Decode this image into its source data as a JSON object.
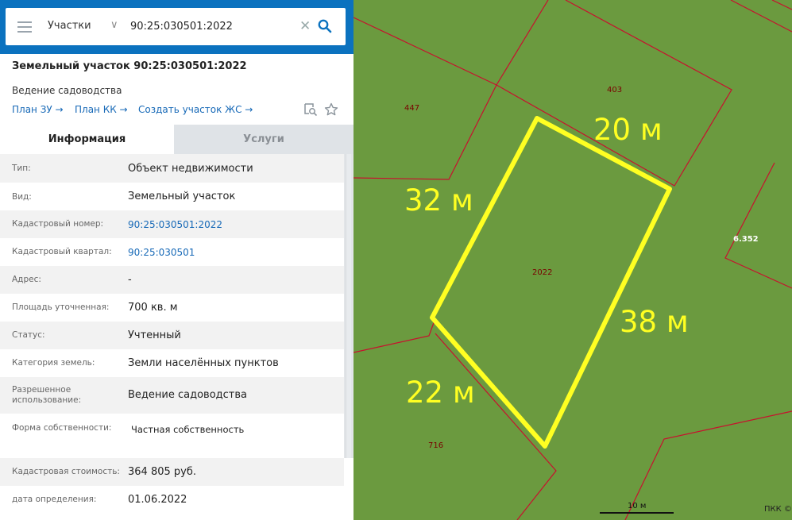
{
  "search": {
    "layer": "Участки",
    "query": "90:25:030501:2022"
  },
  "header": {
    "title": "Земельный участок 90:25:030501:2022",
    "subtitle": "Ведение садоводства",
    "links": [
      "План ЗУ →",
      "План КК →",
      "Создать участок ЖС →"
    ]
  },
  "tabs": [
    "Информация",
    "Услуги"
  ],
  "info": [
    {
      "key": "Тип:",
      "value": "Объект недвижимости"
    },
    {
      "key": "Вид:",
      "value": "Земельный участок"
    },
    {
      "key": "Кадастровый номер:",
      "value": "90:25:030501:2022"
    },
    {
      "key": "Кадастровый квартал:",
      "value": "90:25:030501"
    },
    {
      "key": "Адрес:",
      "value": "-"
    },
    {
      "key": "Площадь уточненная:",
      "value": "700 кв. м"
    },
    {
      "key": "Статус:",
      "value": "Учтенный"
    },
    {
      "key": "Категория земель:",
      "value": "Земли населённых пунктов"
    },
    {
      "key": "Разрешенное использование:",
      "value": "Ведение садоводства"
    },
    {
      "key": "Форма собственности:",
      "value": "Частная собственность"
    },
    {
      "key": "Кадастровая стоимость:",
      "value": "364 805 руб."
    },
    {
      "key": "дата определения:",
      "value": "01.06.2022"
    }
  ],
  "map": {
    "parcel_labels": [
      "447",
      "403",
      "2022",
      "6.352",
      "716"
    ],
    "dimensions": [
      "20 м",
      "32 м",
      "38 м",
      "22 м"
    ],
    "scale": "10 м",
    "copyright": "ПКК ©",
    "colors": {
      "land": "#6b9a3f",
      "boundary": "#c8102e",
      "highlight": "#ffff22"
    }
  },
  "colors": {
    "accent": "#0b72bf",
    "link": "#1769b7"
  }
}
